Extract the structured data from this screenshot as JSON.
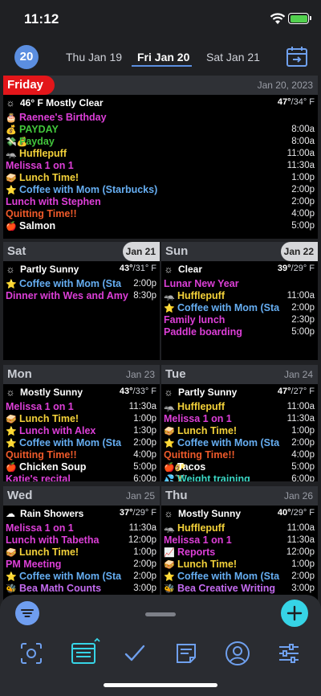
{
  "status": {
    "time": "11:12"
  },
  "header": {
    "today_day": "20",
    "prev_tab": "Thu  Jan 19",
    "cur_tab": "Fri  Jan 20",
    "next_tab": "Sat  Jan 21"
  },
  "days": [
    {
      "name": "Friday",
      "date": "Jan 20, 2023",
      "weather": {
        "condition": "46° F Mostly Clear",
        "hi": "47°",
        "lo": "/34° F"
      },
      "events": [
        {
          "icon": "🎂",
          "title": "Raenee's Birthday",
          "time": "",
          "color": "mag"
        },
        {
          "icon": "💰",
          "title": "PAYDAY",
          "time": "8:00a",
          "color": "grn"
        },
        {
          "icon": "💸💰",
          "title": "Payday",
          "time": "8:00a",
          "color": "grn"
        },
        {
          "icon": "🦡",
          "title": "Hufflepuff",
          "time": "11:00a",
          "color": "yel"
        },
        {
          "icon": "",
          "title": "Melissa 1 on 1",
          "time": "11:30a",
          "color": "mag"
        },
        {
          "icon": "🥪",
          "title": "Lunch Time!",
          "time": "1:00p",
          "color": "yel"
        },
        {
          "icon": "⭐",
          "title": "Coffee with Mom (Starbucks)",
          "time": "2:00p",
          "color": "blu"
        },
        {
          "icon": "",
          "title": "Lunch with Stephen",
          "time": "2:00p",
          "color": "mag"
        },
        {
          "icon": "",
          "title": "Quitting Time!!",
          "time": "4:00p",
          "color": "org"
        },
        {
          "icon": "🍎",
          "title": "Salmon",
          "time": "5:00p",
          "color": "wht"
        }
      ]
    },
    {
      "name": "Sat",
      "date": "Jan 21",
      "weather": {
        "condition": "Partly Sunny",
        "hi": "43°",
        "lo": "/31° F"
      },
      "events": [
        {
          "icon": "⭐",
          "title": "Coffee with Mom (Sta",
          "time": "2:00p",
          "color": "blu"
        },
        {
          "icon": "",
          "title": "Dinner with Wes and Amy",
          "time": "8:30p",
          "color": "mag"
        }
      ]
    },
    {
      "name": "Sun",
      "date": "Jan 22",
      "weather": {
        "condition": "Clear",
        "hi": "39°",
        "lo": "/29° F"
      },
      "events": [
        {
          "icon": "",
          "title": "Lunar New Year",
          "time": "",
          "color": "mag"
        },
        {
          "icon": "🦡",
          "title": "Hufflepuff",
          "time": "11:00a",
          "color": "yel"
        },
        {
          "icon": "⭐",
          "title": "Coffee with Mom (Sta",
          "time": "2:00p",
          "color": "blu"
        },
        {
          "icon": "",
          "title": "Family lunch",
          "time": "2:30p",
          "color": "mag"
        },
        {
          "icon": "",
          "title": "Paddle boarding",
          "time": "5:00p",
          "color": "mag"
        }
      ]
    },
    {
      "name": "Mon",
      "date": "Jan 23",
      "weather": {
        "condition": "Mostly Sunny",
        "hi": "43°",
        "lo": "/33° F"
      },
      "events": [
        {
          "icon": "",
          "title": "Melissa 1 on 1",
          "time": "11:30a",
          "color": "mag"
        },
        {
          "icon": "🥪",
          "title": "Lunch Time!",
          "time": "1:00p",
          "color": "yel"
        },
        {
          "icon": "⭐",
          "title": "Lunch with Alex",
          "time": "1:30p",
          "color": "mag"
        },
        {
          "icon": "⭐",
          "title": "Coffee with Mom (Sta",
          "time": "2:00p",
          "color": "blu"
        },
        {
          "icon": "",
          "title": "Quitting Time!!",
          "time": "4:00p",
          "color": "org"
        },
        {
          "icon": "🍎",
          "title": "Chicken Soup",
          "time": "5:00p",
          "color": "wht"
        },
        {
          "icon": "",
          "title": "Katie's recital",
          "time": "6:00p",
          "color": "mag"
        }
      ]
    },
    {
      "name": "Tue",
      "date": "Jan 24",
      "weather": {
        "condition": "Partly Sunny",
        "hi": "47°",
        "lo": "/27° F"
      },
      "events": [
        {
          "icon": "🦡",
          "title": "Hufflepuff",
          "time": "11:00a",
          "color": "yel"
        },
        {
          "icon": "",
          "title": "Melissa 1 on 1",
          "time": "11:30a",
          "color": "mag"
        },
        {
          "icon": "🥪",
          "title": "Lunch Time!",
          "time": "1:00p",
          "color": "yel"
        },
        {
          "icon": "⭐",
          "title": "Coffee with Mom (Sta",
          "time": "2:00p",
          "color": "blu"
        },
        {
          "icon": "",
          "title": "Quitting Time!!",
          "time": "4:00p",
          "color": "org"
        },
        {
          "icon": "🍎🌮",
          "title": "Tacos",
          "time": "5:00p",
          "color": "wht"
        },
        {
          "icon": "💦🏋",
          "title": "Weight training",
          "time": "6:00p",
          "color": "tea"
        }
      ]
    },
    {
      "name": "Wed",
      "date": "Jan 25",
      "weather": {
        "condition": "Rain Showers",
        "hi": "37°",
        "lo": "/29° F"
      },
      "events": [
        {
          "icon": "",
          "title": "Melissa 1 on 1",
          "time": "11:30a",
          "color": "mag"
        },
        {
          "icon": "",
          "title": "Lunch with Tabetha",
          "time": "12:00p",
          "color": "mag"
        },
        {
          "icon": "🥪",
          "title": "Lunch Time!",
          "time": "1:00p",
          "color": "yel"
        },
        {
          "icon": "",
          "title": "PM Meeting",
          "time": "2:00p",
          "color": "mag"
        },
        {
          "icon": "⭐",
          "title": "Coffee with Mom (Sta",
          "time": "2:00p",
          "color": "blu"
        },
        {
          "icon": "🐝",
          "title": "Bea Math Counts",
          "time": "3:00p",
          "color": "pur"
        }
      ]
    },
    {
      "name": "Thu",
      "date": "Jan 26",
      "weather": {
        "condition": "Mostly Sunny",
        "hi": "40°",
        "lo": "/29° F"
      },
      "events": [
        {
          "icon": "🦡",
          "title": "Hufflepuff",
          "time": "11:00a",
          "color": "yel"
        },
        {
          "icon": "",
          "title": "Melissa 1 on 1",
          "time": "11:30a",
          "color": "mag"
        },
        {
          "icon": "📈",
          "title": "Reports",
          "time": "12:00p",
          "color": "mag"
        },
        {
          "icon": "🥪",
          "title": "Lunch Time!",
          "time": "1:00p",
          "color": "yel"
        },
        {
          "icon": "⭐",
          "title": "Coffee with Mom (Sta",
          "time": "2:00p",
          "color": "blu"
        },
        {
          "icon": "🐝",
          "title": "Bea Creative Writing",
          "time": "3:00p",
          "color": "pur"
        }
      ]
    }
  ],
  "tabbar": {
    "icons": [
      "focus-icon",
      "calendar-icon",
      "checkmark-icon",
      "notes-icon",
      "profile-icon",
      "settings-sliders-icon"
    ]
  }
}
